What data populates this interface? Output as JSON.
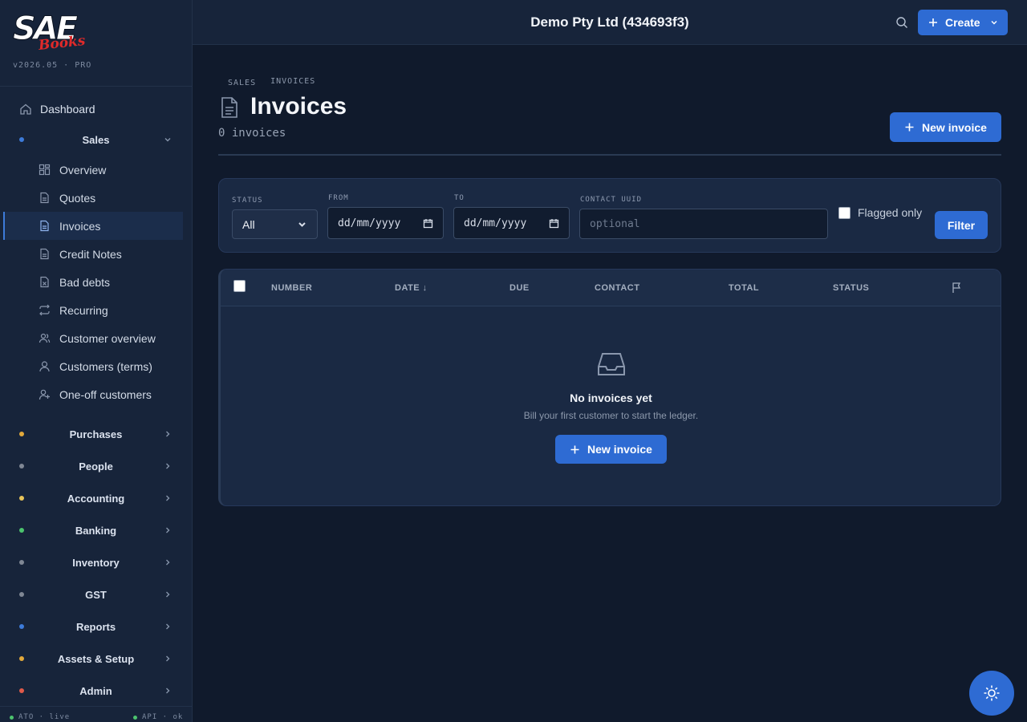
{
  "brand": {
    "logo_main": "SAE",
    "logo_sub": "Books",
    "version": "v2026.05 · PRO"
  },
  "header": {
    "company": "Demo Pty Ltd (434693f3)",
    "create_label": "Create"
  },
  "sidebar": {
    "dashboard": "Dashboard",
    "sales": {
      "label": "Sales",
      "dot_color": "#3d7bd9"
    },
    "sales_items": [
      {
        "label": "Overview",
        "icon": "overview-icon"
      },
      {
        "label": "Quotes",
        "icon": "document-icon"
      },
      {
        "label": "Invoices",
        "icon": "document-icon"
      },
      {
        "label": "Credit Notes",
        "icon": "document-icon"
      },
      {
        "label": "Bad debts",
        "icon": "document-x-icon"
      },
      {
        "label": "Recurring",
        "icon": "recurring-icon"
      },
      {
        "label": "Customer overview",
        "icon": "users-icon"
      },
      {
        "label": "Customers (terms)",
        "icon": "user-icon"
      },
      {
        "label": "One-off customers",
        "icon": "user-plus-icon"
      }
    ],
    "groups": [
      {
        "label": "Purchases",
        "dot_color": "#e2a93b"
      },
      {
        "label": "People",
        "dot_color": "#7f8794"
      },
      {
        "label": "Accounting",
        "dot_color": "#e8c45a"
      },
      {
        "label": "Banking",
        "dot_color": "#4cc46e"
      },
      {
        "label": "Inventory",
        "dot_color": "#7f8794"
      },
      {
        "label": "GST",
        "dot_color": "#7f8794"
      },
      {
        "label": "Reports",
        "dot_color": "#3d7bd9"
      },
      {
        "label": "Assets & Setup",
        "dot_color": "#e2a93b"
      },
      {
        "label": "Admin",
        "dot_color": "#e05a4a"
      }
    ],
    "footer": {
      "left": "ATO · live",
      "right": "API · ok",
      "status_color": "#4cc46e"
    }
  },
  "page": {
    "breadcrumb": [
      "SALES",
      "INVOICES"
    ],
    "title": "Invoices",
    "count": "0 invoices",
    "new_invoice_label": "New invoice"
  },
  "filters": {
    "status_label": "STATUS",
    "status_value": "All",
    "from_label": "FROM",
    "from_placeholder": "dd/mm/yyyy",
    "to_label": "TO",
    "to_placeholder": "dd/mm/yyyy",
    "contact_label": "CONTACT UUID",
    "contact_placeholder": "optional",
    "flagged_label": "Flagged only",
    "filter_button": "Filter"
  },
  "table": {
    "columns": [
      "NUMBER",
      "DATE ↓",
      "DUE",
      "CONTACT",
      "TOTAL",
      "STATUS"
    ],
    "empty_title": "No invoices yet",
    "empty_subtitle": "Bill your first customer to start the ledger.",
    "empty_button": "New invoice"
  },
  "colors": {
    "accent": "#2e6bd3",
    "background": "#101a2c",
    "sidebar": "#17243a"
  }
}
